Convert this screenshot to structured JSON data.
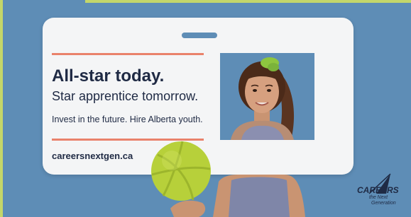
{
  "ad": {
    "headline": "All-star today.",
    "subheadline": "Star apprentice tomorrow.",
    "tagline": "Invest in the future. Hire Alberta youth.",
    "url": "careersnextgen.ca"
  },
  "logo": {
    "line1": "CAREERS",
    "line2": "the Next",
    "line3": "Generation"
  },
  "colors": {
    "background": "#5e8db6",
    "card": "#f4f5f6",
    "accent_rule": "#e9826b",
    "text": "#1f2a44",
    "ball": "#b7d03a",
    "lime_border": "#c4d66a"
  },
  "icons": [
    "volleyball-icon",
    "careers-logo-icon"
  ]
}
